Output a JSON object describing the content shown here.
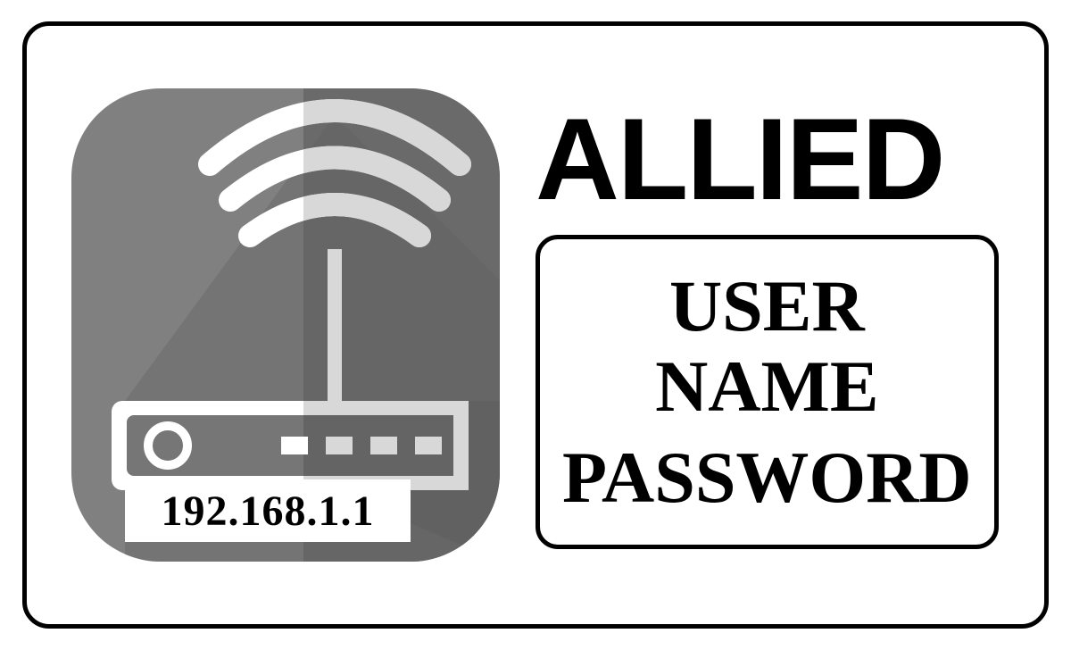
{
  "icon": {
    "name": "router-wifi-icon",
    "ip_address": "192.168.1.1"
  },
  "content": {
    "title": "ALLIED",
    "credentials": {
      "line1": "USER NAME",
      "line2": "PASSWORD"
    }
  }
}
